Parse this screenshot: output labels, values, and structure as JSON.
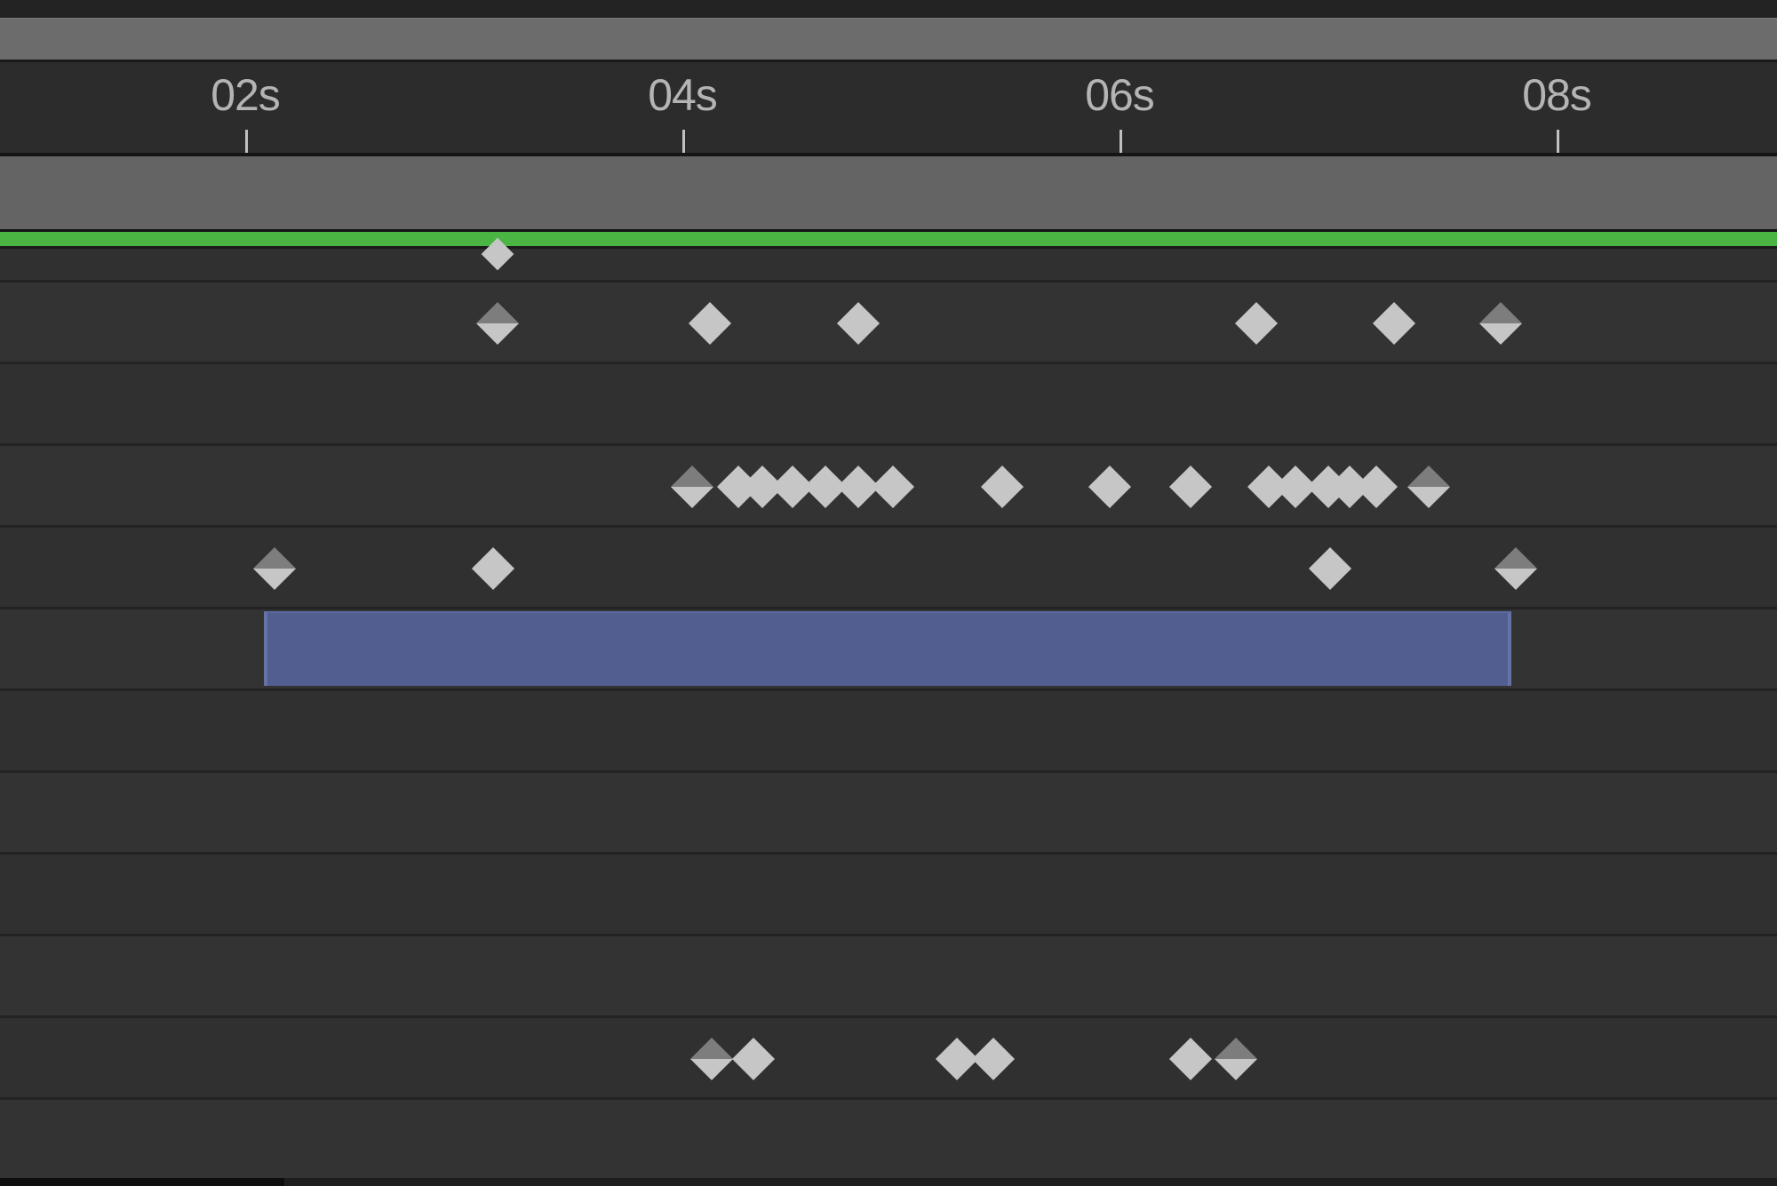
{
  "ruler": {
    "ticks": [
      {
        "label": "02s",
        "seconds": 2
      },
      {
        "label": "04s",
        "seconds": 4
      },
      {
        "label": "06s",
        "seconds": 6
      },
      {
        "label": "08s",
        "seconds": 8
      }
    ]
  },
  "colors": {
    "background": "#2b2b2b",
    "work_area": "#646464",
    "cti_line": "#4bb543",
    "keyframe": "#c6c6c6",
    "keyframe_shade": "#7d7d7d",
    "layer_bar": "#525e8f"
  },
  "tracks": [
    {
      "keyframes": [
        {
          "t": 3.15,
          "type": "partial"
        }
      ]
    },
    {
      "keyframes": [
        {
          "t": 3.15,
          "type": "ease-in"
        },
        {
          "t": 4.12,
          "type": "linear"
        },
        {
          "t": 4.8,
          "type": "linear"
        },
        {
          "t": 6.62,
          "type": "linear"
        },
        {
          "t": 7.25,
          "type": "linear"
        },
        {
          "t": 7.74,
          "type": "ease-in"
        }
      ]
    },
    {
      "keyframes": []
    },
    {
      "keyframes": [
        {
          "t": 4.04,
          "type": "ease-in"
        },
        {
          "t": 4.25,
          "type": "linear"
        },
        {
          "t": 4.36,
          "type": "linear"
        },
        {
          "t": 4.5,
          "type": "linear"
        },
        {
          "t": 4.65,
          "type": "linear"
        },
        {
          "t": 4.8,
          "type": "linear"
        },
        {
          "t": 4.96,
          "type": "linear"
        },
        {
          "t": 5.46,
          "type": "linear"
        },
        {
          "t": 5.95,
          "type": "linear"
        },
        {
          "t": 6.32,
          "type": "linear"
        },
        {
          "t": 6.68,
          "type": "linear"
        },
        {
          "t": 6.8,
          "type": "linear"
        },
        {
          "t": 6.95,
          "type": "linear"
        },
        {
          "t": 7.05,
          "type": "linear"
        },
        {
          "t": 7.17,
          "type": "linear"
        },
        {
          "t": 7.41,
          "type": "ease-in"
        }
      ]
    },
    {
      "keyframes": [
        {
          "t": 2.13,
          "type": "ease-in"
        },
        {
          "t": 3.13,
          "type": "linear"
        },
        {
          "t": 6.96,
          "type": "linear"
        },
        {
          "t": 7.81,
          "type": "ease-in"
        }
      ]
    },
    {
      "layer_bar": {
        "start": 2.08,
        "end": 7.79
      }
    },
    {
      "keyframes": []
    },
    {
      "keyframes": []
    },
    {
      "keyframes": []
    },
    {
      "keyframes": []
    },
    {
      "keyframes": [
        {
          "t": 4.13,
          "type": "ease-in"
        },
        {
          "t": 4.32,
          "type": "linear"
        },
        {
          "t": 5.25,
          "type": "linear"
        },
        {
          "t": 5.42,
          "type": "linear"
        },
        {
          "t": 6.32,
          "type": "linear"
        },
        {
          "t": 6.53,
          "type": "ease-in"
        }
      ]
    },
    {
      "keyframes": []
    }
  ]
}
